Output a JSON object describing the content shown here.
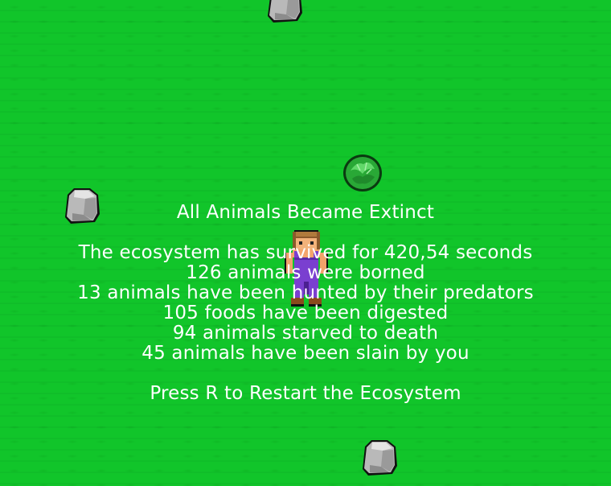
{
  "game_over": {
    "title": "All Animals Became Extinct",
    "stats": [
      "The ecosystem has survived for 420,54 seconds",
      "126 animals were borned",
      "13 animals have been hunted by their predators",
      "105 foods have been digested",
      "94 animals starved to death",
      "45 animals have been slain by you"
    ],
    "restart_hint": "Press R to Restart the Ecosystem"
  },
  "colors": {
    "grass": "#11c52a",
    "text": "#ffffff",
    "rock": "#b8b8b8",
    "bush": "#2fbf3a",
    "player_overalls": "#7a3fd0",
    "player_hair": "#8a5a2b"
  },
  "sprites": [
    "rock-icon",
    "bush-icon",
    "player-character"
  ]
}
